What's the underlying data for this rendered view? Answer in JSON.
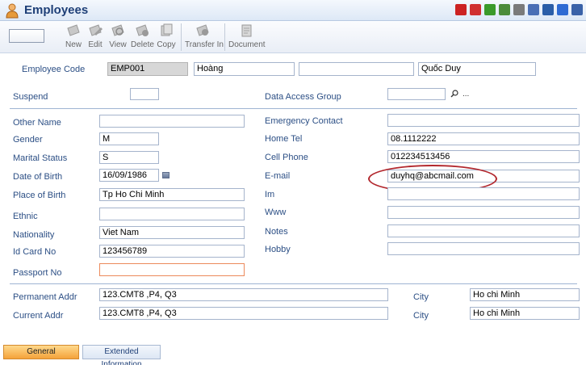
{
  "window": {
    "title": "Employees"
  },
  "header_icons": [
    {
      "name": "add-icon",
      "color": "#cc2222"
    },
    {
      "name": "bookmark-icon",
      "color": "#d03030"
    },
    {
      "name": "refresh-icon",
      "color": "#3a9a2a"
    },
    {
      "name": "chart-icon",
      "color": "#4c8c3a"
    },
    {
      "name": "clock-icon",
      "color": "#7a7a7a"
    },
    {
      "name": "document-icon",
      "color": "#4a6fb5"
    },
    {
      "name": "device-icon",
      "color": "#2a5ea8"
    },
    {
      "name": "help-icon",
      "color": "#2e6bd3"
    },
    {
      "name": "pin-icon",
      "color": "#3a62a8"
    }
  ],
  "toolbar": {
    "new_label": "New",
    "edit_label": "Edit",
    "view_label": "View",
    "delete_label": "Delete",
    "copy_label": "Copy",
    "transfer_label": "Transfer In",
    "document_label": "Document"
  },
  "form": {
    "employee_code": {
      "label": "Employee Code",
      "value": "EMP001",
      "first_name": "Hoàng",
      "middle_name": "",
      "last_name": "Quốc Duy"
    },
    "suspend": {
      "label": "Suspend",
      "value": ""
    },
    "data_access_group": {
      "label": "Data Access Group",
      "value": "",
      "more": "..."
    },
    "other_name": {
      "label": "Other Name",
      "value": ""
    },
    "gender": {
      "label": "Gender",
      "value": "M"
    },
    "marital_status": {
      "label": "Marital Status",
      "value": "S"
    },
    "date_of_birth": {
      "label": "Date of Birth",
      "value": "16/09/1986"
    },
    "place_of_birth": {
      "label": "Place of Birth",
      "value": "Tp Ho Chi Minh"
    },
    "ethnic": {
      "label": "Ethnic",
      "value": ""
    },
    "nationality": {
      "label": "Nationality",
      "value": "Viet Nam"
    },
    "id_card_no": {
      "label": "Id Card No",
      "value": "123456789"
    },
    "passport_no": {
      "label": "Passport No",
      "value": ""
    },
    "emergency_contact": {
      "label": "Emergency Contact",
      "value": ""
    },
    "home_tel": {
      "label": "Home Tel",
      "value": "08.1112222"
    },
    "cell_phone": {
      "label": "Cell Phone",
      "value": "012234513456"
    },
    "email": {
      "label": "E-mail",
      "value": "duyhq@abcmail.com"
    },
    "im": {
      "label": "Im",
      "value": ""
    },
    "www": {
      "label": "Www",
      "value": ""
    },
    "notes": {
      "label": "Notes",
      "value": ""
    },
    "hobby": {
      "label": "Hobby",
      "value": ""
    },
    "permanent_addr": {
      "label": "Permanent Addr",
      "value": "123.CMT8 ,P4, Q3",
      "city_label": "City",
      "city": "Ho chi Minh"
    },
    "current_addr": {
      "label": "Current Addr",
      "value": "123.CMT8 ,P4, Q3",
      "city_label": "City",
      "city": "Ho chi Minh"
    }
  },
  "tabs": {
    "general": "General",
    "extended": "Extended Information"
  }
}
